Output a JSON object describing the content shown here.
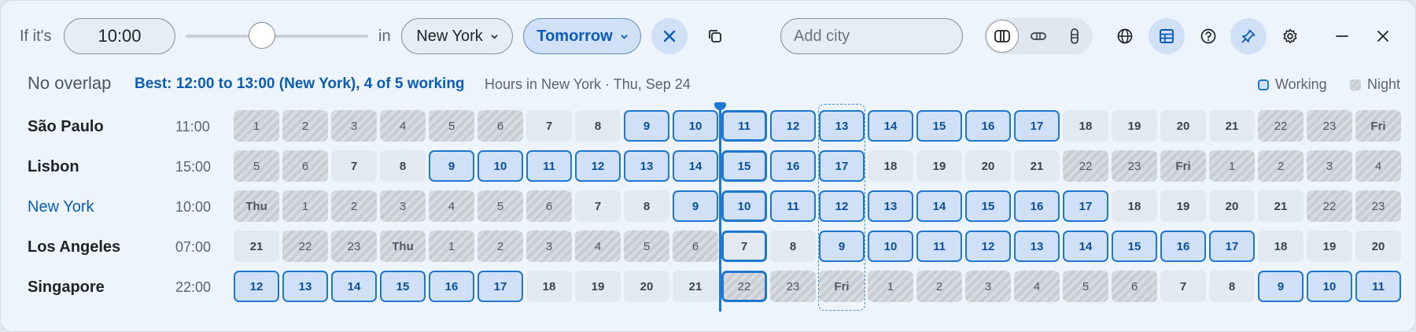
{
  "toolbar": {
    "if_label": "If it's",
    "time_value": "10:00",
    "in_label": "in",
    "city_select": "New York",
    "day_select": "Tomorrow",
    "add_city_placeholder": "Add city"
  },
  "summary": {
    "status": "No overlap",
    "best": "Best: 12:00 to 13:00 (New York), 4 of 5 working",
    "hours_info": "Hours in New York · Thu, Sep 24"
  },
  "legend": {
    "working": "Working",
    "night": "Night"
  },
  "slider": {
    "value_fraction": 0.42
  },
  "accent_color": "#1f77d0",
  "rows": [
    {
      "city": "São Paulo",
      "time": "11:00",
      "home": false,
      "cells": [
        {
          "t": "1",
          "k": "night"
        },
        {
          "t": "2",
          "k": "night"
        },
        {
          "t": "3",
          "k": "night"
        },
        {
          "t": "4",
          "k": "night"
        },
        {
          "t": "5",
          "k": "night"
        },
        {
          "t": "6",
          "k": "night"
        },
        {
          "t": "7",
          "k": "day"
        },
        {
          "t": "8",
          "k": "day"
        },
        {
          "t": "9",
          "k": "work"
        },
        {
          "t": "10",
          "k": "work"
        },
        {
          "t": "11",
          "k": "work"
        },
        {
          "t": "12",
          "k": "work"
        },
        {
          "t": "13",
          "k": "work"
        },
        {
          "t": "14",
          "k": "work"
        },
        {
          "t": "15",
          "k": "work"
        },
        {
          "t": "16",
          "k": "work"
        },
        {
          "t": "17",
          "k": "work"
        },
        {
          "t": "18",
          "k": "day"
        },
        {
          "t": "19",
          "k": "day"
        },
        {
          "t": "20",
          "k": "day"
        },
        {
          "t": "21",
          "k": "day"
        },
        {
          "t": "22",
          "k": "night"
        },
        {
          "t": "23",
          "k": "night"
        },
        {
          "t": "Fri",
          "k": "night",
          "d": true
        }
      ]
    },
    {
      "city": "Lisbon",
      "time": "15:00",
      "home": false,
      "cells": [
        {
          "t": "5",
          "k": "night"
        },
        {
          "t": "6",
          "k": "night"
        },
        {
          "t": "7",
          "k": "day"
        },
        {
          "t": "8",
          "k": "day"
        },
        {
          "t": "9",
          "k": "work"
        },
        {
          "t": "10",
          "k": "work"
        },
        {
          "t": "11",
          "k": "work"
        },
        {
          "t": "12",
          "k": "work"
        },
        {
          "t": "13",
          "k": "work"
        },
        {
          "t": "14",
          "k": "work"
        },
        {
          "t": "15",
          "k": "work"
        },
        {
          "t": "16",
          "k": "work"
        },
        {
          "t": "17",
          "k": "work"
        },
        {
          "t": "18",
          "k": "day"
        },
        {
          "t": "19",
          "k": "day"
        },
        {
          "t": "20",
          "k": "day"
        },
        {
          "t": "21",
          "k": "day"
        },
        {
          "t": "22",
          "k": "night"
        },
        {
          "t": "23",
          "k": "night"
        },
        {
          "t": "Fri",
          "k": "night",
          "d": true
        },
        {
          "t": "1",
          "k": "night"
        },
        {
          "t": "2",
          "k": "night"
        },
        {
          "t": "3",
          "k": "night"
        },
        {
          "t": "4",
          "k": "night"
        }
      ]
    },
    {
      "city": "New York",
      "time": "10:00",
      "home": true,
      "cells": [
        {
          "t": "Thu",
          "k": "night",
          "d": true
        },
        {
          "t": "1",
          "k": "night"
        },
        {
          "t": "2",
          "k": "night"
        },
        {
          "t": "3",
          "k": "night"
        },
        {
          "t": "4",
          "k": "night"
        },
        {
          "t": "5",
          "k": "night"
        },
        {
          "t": "6",
          "k": "night"
        },
        {
          "t": "7",
          "k": "day"
        },
        {
          "t": "8",
          "k": "day"
        },
        {
          "t": "9",
          "k": "work"
        },
        {
          "t": "10",
          "k": "work"
        },
        {
          "t": "11",
          "k": "work"
        },
        {
          "t": "12",
          "k": "work"
        },
        {
          "t": "13",
          "k": "work"
        },
        {
          "t": "14",
          "k": "work"
        },
        {
          "t": "15",
          "k": "work"
        },
        {
          "t": "16",
          "k": "work"
        },
        {
          "t": "17",
          "k": "work"
        },
        {
          "t": "18",
          "k": "day"
        },
        {
          "t": "19",
          "k": "day"
        },
        {
          "t": "20",
          "k": "day"
        },
        {
          "t": "21",
          "k": "day"
        },
        {
          "t": "22",
          "k": "night"
        },
        {
          "t": "23",
          "k": "night"
        }
      ]
    },
    {
      "city": "Los Angeles",
      "time": "07:00",
      "home": false,
      "cells": [
        {
          "t": "21",
          "k": "day"
        },
        {
          "t": "22",
          "k": "night"
        },
        {
          "t": "23",
          "k": "night"
        },
        {
          "t": "Thu",
          "k": "night",
          "d": true
        },
        {
          "t": "1",
          "k": "night"
        },
        {
          "t": "2",
          "k": "night"
        },
        {
          "t": "3",
          "k": "night"
        },
        {
          "t": "4",
          "k": "night"
        },
        {
          "t": "5",
          "k": "night"
        },
        {
          "t": "6",
          "k": "night"
        },
        {
          "t": "7",
          "k": "day"
        },
        {
          "t": "8",
          "k": "day"
        },
        {
          "t": "9",
          "k": "work"
        },
        {
          "t": "10",
          "k": "work"
        },
        {
          "t": "11",
          "k": "work"
        },
        {
          "t": "12",
          "k": "work"
        },
        {
          "t": "13",
          "k": "work"
        },
        {
          "t": "14",
          "k": "work"
        },
        {
          "t": "15",
          "k": "work"
        },
        {
          "t": "16",
          "k": "work"
        },
        {
          "t": "17",
          "k": "work"
        },
        {
          "t": "18",
          "k": "day"
        },
        {
          "t": "19",
          "k": "day"
        },
        {
          "t": "20",
          "k": "day"
        }
      ]
    },
    {
      "city": "Singapore",
      "time": "22:00",
      "home": false,
      "cells": [
        {
          "t": "12",
          "k": "work"
        },
        {
          "t": "13",
          "k": "work"
        },
        {
          "t": "14",
          "k": "work"
        },
        {
          "t": "15",
          "k": "work"
        },
        {
          "t": "16",
          "k": "work"
        },
        {
          "t": "17",
          "k": "work"
        },
        {
          "t": "18",
          "k": "day"
        },
        {
          "t": "19",
          "k": "day"
        },
        {
          "t": "20",
          "k": "day"
        },
        {
          "t": "21",
          "k": "day"
        },
        {
          "t": "22",
          "k": "night"
        },
        {
          "t": "23",
          "k": "night"
        },
        {
          "t": "Fri",
          "k": "night",
          "d": true
        },
        {
          "t": "1",
          "k": "night"
        },
        {
          "t": "2",
          "k": "night"
        },
        {
          "t": "3",
          "k": "night"
        },
        {
          "t": "4",
          "k": "night"
        },
        {
          "t": "5",
          "k": "night"
        },
        {
          "t": "6",
          "k": "night"
        },
        {
          "t": "7",
          "k": "day"
        },
        {
          "t": "8",
          "k": "day"
        },
        {
          "t": "9",
          "k": "work"
        },
        {
          "t": "10",
          "k": "work"
        },
        {
          "t": "11",
          "k": "work"
        }
      ]
    }
  ],
  "now_column": 10,
  "best_column": 12,
  "icons": {
    "clear": "close-icon",
    "copy": "copy-icon",
    "layout_columns": "columns-icon",
    "layout_rows": "rows-icon",
    "layout_stack": "stack-icon",
    "globe": "globe-icon",
    "table": "table-icon",
    "help": "help-icon",
    "pin": "pin-icon",
    "settings": "gear-icon",
    "minimize": "minimize-icon",
    "close": "window-close-icon"
  }
}
